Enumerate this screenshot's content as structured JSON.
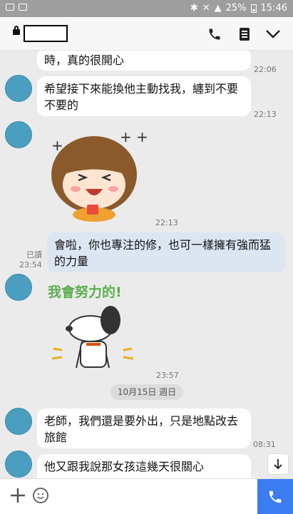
{
  "status_bar": {
    "battery": "25%",
    "time": "15:46"
  },
  "header": {
    "title": ""
  },
  "messages": [
    {
      "text": "時，真的很開心",
      "time": "22:06"
    },
    {
      "text": "希望接下來能換他主動找我，纏到不要不要的",
      "time": "22:13"
    },
    {
      "sticker_time": "22:13"
    },
    {
      "text": "會啦，你也專注的修，也可一樣擁有強而猛的力量",
      "read": "已讀",
      "time": "23:54"
    },
    {
      "sticker_text": "我會努力的!",
      "sticker_time": "23:57"
    },
    {
      "text": "老師，我們還是要外出，只是地點改去旅館",
      "time": "08:31"
    },
    {
      "text": "他又跟我說那女孩這幾天很關心"
    }
  ],
  "date_separator": "10月15日 週日",
  "icons": [
    "lock-icon",
    "phone-icon",
    "notes-icon",
    "chevron-down-icon",
    "arrow-down-icon",
    "plus-icon",
    "emoji-icon",
    "phone-icon"
  ],
  "colors": {
    "accent": "#3b7cf0",
    "avatar": "#4a9fc0",
    "outgoing_bubble": "#dce6f2",
    "chat_bg": "#ebebeb"
  }
}
